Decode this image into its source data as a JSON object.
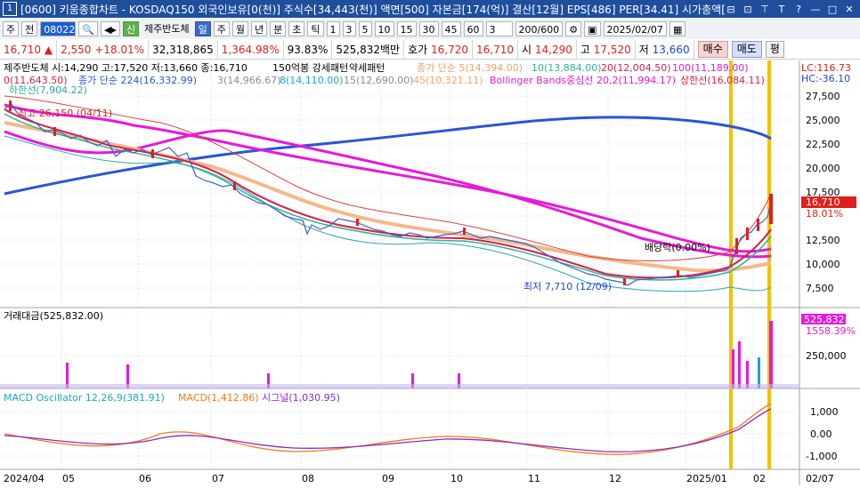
{
  "window": {
    "number": "1",
    "title": "[0600] 키움종합차트 - KOSDAQ150 외국인보유[0(천)] 주식수[34,443(천)] 액면[500] 자본금[174(억)] 결산[12월] EPS[486] PER[34.41] 시가총액[5",
    "buttons": [
      "⊟",
      "⊡",
      "⊤",
      "T",
      "?",
      "—",
      "□",
      "✕"
    ]
  },
  "toolbar": {
    "stock_code": "080220",
    "items": [
      "주",
      "전"
    ],
    "stock_name": "제주반도체",
    "new_label": "신",
    "periods": [
      "일",
      "주",
      "월",
      "년",
      "분",
      "초",
      "틱"
    ],
    "selected_period": "일",
    "intervals": [
      "1",
      "3",
      "5",
      "10",
      "15",
      "30",
      "45",
      "60"
    ],
    "interval_extra": "3",
    "count": "200/600",
    "date": "2025/02/07"
  },
  "infobar": {
    "price": "16,710",
    "arrow": "▲",
    "change": "2,550",
    "change_pct": "+18.01%",
    "volume": "32,318,865",
    "volume_pct": "1,364.98%",
    "strength": "93.83%",
    "amount": "525,832백만",
    "ask_label": "호가",
    "ask": "16,720",
    "bid": "16,710",
    "open_label": "시",
    "open": "14,290",
    "high_label": "고",
    "high": "17,520",
    "low_label": "저",
    "low": "13,660",
    "buy": "매수",
    "sell": "매도",
    "avg": "평"
  },
  "price_panel": {
    "header_line1": "제주반도체 시:14,290 고:17,520 저:13,660 종:16,710",
    "header_line1b": "150억봉 강세패턴",
    "header_line1c": "약세패턴",
    "ma_label": "종가 단순 5(14,394.00)",
    "ma10": "10(13,884.00)",
    "ma20": "20(12,004.50)",
    "ma100": "100(11,189.00)",
    "header_line2a": "0(11,643.50)",
    "header_line2b": "종가 단순 224(16,332.99)",
    "header_line2c": "3(14,966.67)",
    "header_line2d": "8(14,110.00)",
    "header_line2e": "15(12,690.00)",
    "header_line2f": "45(10,321.11)",
    "bb_label": "Bollinger Bands중심선 20,2(11,994.17)",
    "bb_upper": "상한선(16,084.11)",
    "bb_lower": "하한선(7,904.22)",
    "lc": "LC:116.73",
    "hc": "HC:-36.10",
    "high_annot": "최고 26,150 (04/11)",
    "low_annot": "최저 7,710 (12/09)",
    "dividend_annot": "배당락(0.00%)",
    "price_tag": "16,710",
    "pct_tag": "18.01%",
    "yticks": [
      "27,500",
      "25,000",
      "22,500",
      "20,000",
      "17,500",
      "15,000",
      "12,500",
      "10,000",
      "7,500"
    ]
  },
  "volume_panel": {
    "header": "거래대금(525,832.00)",
    "tag": "525,832",
    "tag_pct": "1558.39%",
    "ytick": "250,000"
  },
  "macd_panel": {
    "header_a": "MACD Oscillator 12,26,9(381.91)",
    "header_b": "MACD(1,412.86)",
    "header_c": "시그널(1,030.95)",
    "yticks": [
      "1,000",
      "0.00",
      "-1,000"
    ]
  },
  "xaxis": [
    "2024/04",
    "05",
    "06",
    "07",
    "08",
    "09",
    "10",
    "11",
    "12",
    "2025/01",
    "02",
    "02/07"
  ],
  "colors": {
    "up": "#e0201a",
    "down": "#1d47d8",
    "ma224": "#2b55d6",
    "magenta": "#e51ad9",
    "orange_band": "#f4a26b",
    "highlight": "#f2c200"
  },
  "chart_data": {
    "type": "line",
    "close_path_points": [
      [
        "2024/04",
        26150
      ],
      [
        "05",
        23500
      ],
      [
        "06",
        21000
      ],
      [
        "07",
        18000
      ],
      [
        "08",
        13500
      ],
      [
        "09",
        12800
      ],
      [
        "10",
        13000
      ],
      [
        "11",
        11000
      ],
      [
        "12",
        7710
      ],
      [
        "2025/01",
        9500
      ],
      [
        "02",
        14160
      ],
      [
        "02/07",
        16710
      ]
    ],
    "ma224_points": [
      [
        "2024/04",
        17800
      ],
      [
        "07",
        17600
      ],
      [
        "10",
        18800
      ],
      [
        "11",
        19500
      ],
      [
        "2025/01",
        18500
      ],
      [
        "02/07",
        16333
      ]
    ]
  }
}
